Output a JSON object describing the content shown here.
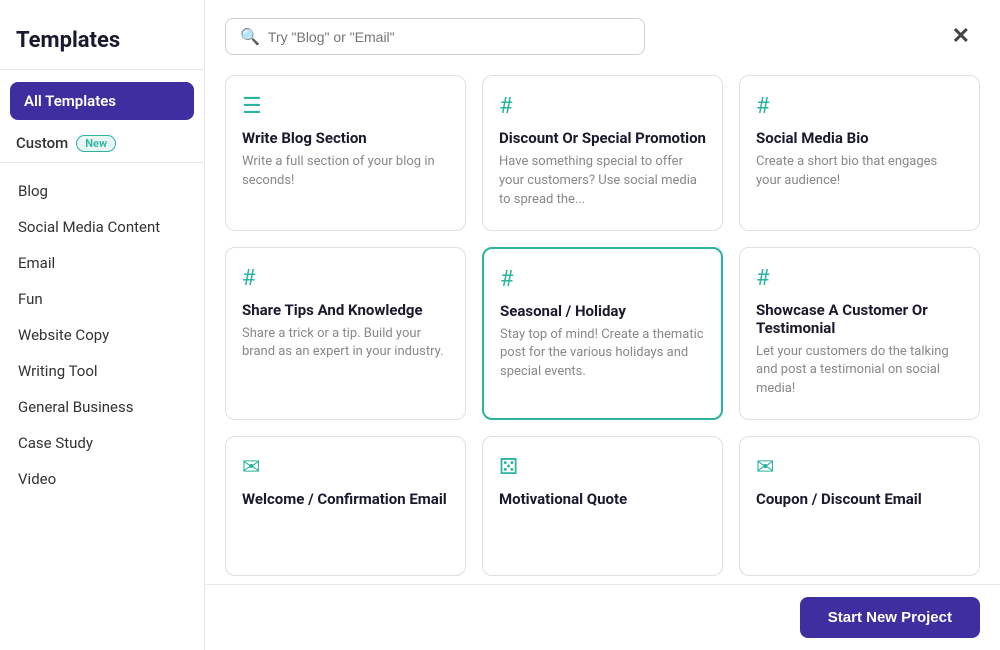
{
  "sidebar": {
    "title": "Templates",
    "all_templates_label": "All Templates",
    "custom_label": "Custom",
    "new_badge": "New",
    "nav_items": [
      {
        "label": "Blog",
        "id": "blog"
      },
      {
        "label": "Social Media Content",
        "id": "social-media-content"
      },
      {
        "label": "Email",
        "id": "email"
      },
      {
        "label": "Fun",
        "id": "fun"
      },
      {
        "label": "Website Copy",
        "id": "website-copy"
      },
      {
        "label": "Writing Tool",
        "id": "writing-tool"
      },
      {
        "label": "General Business",
        "id": "general-business"
      },
      {
        "label": "Case Study",
        "id": "case-study"
      },
      {
        "label": "Video",
        "id": "video"
      }
    ]
  },
  "search": {
    "placeholder": "Try \"Blog\" or \"Email\""
  },
  "close_button": "✕",
  "cards": [
    {
      "id": "write-blog-section",
      "icon": "☰",
      "icon_type": "teal",
      "title": "Write Blog Section",
      "description": "Write a full section of your blog in seconds!",
      "highlighted": false
    },
    {
      "id": "discount-or-special-promotion",
      "icon": "#",
      "icon_type": "teal",
      "title": "Discount Or Special Promotion",
      "description": "Have something special to offer your customers? Use social media to spread the...",
      "highlighted": false
    },
    {
      "id": "social-media-bio",
      "icon": "#",
      "icon_type": "teal",
      "title": "Social Media Bio",
      "description": "Create a short bio that engages your audience!",
      "highlighted": false
    },
    {
      "id": "share-tips-and-knowledge",
      "icon": "#",
      "icon_type": "teal",
      "title": "Share Tips And Knowledge",
      "description": "Share a trick or a tip. Build your brand as an expert in your industry.",
      "highlighted": false
    },
    {
      "id": "seasonal-holiday",
      "icon": "#",
      "icon_type": "teal",
      "title": "Seasonal / Holiday",
      "description": "Stay top of mind! Create a thematic post for the various holidays and special events.",
      "highlighted": true
    },
    {
      "id": "showcase-customer-testimonial",
      "icon": "#",
      "icon_type": "teal",
      "title": "Showcase A Customer Or Testimonial",
      "description": "Let your customers do the talking and post a testimonial on social media!",
      "highlighted": false
    },
    {
      "id": "welcome-confirmation-email",
      "icon": "✉",
      "icon_type": "teal",
      "title": "Welcome / Confirmation Email",
      "description": "",
      "highlighted": false
    },
    {
      "id": "motivational-quote",
      "icon": "⚄",
      "icon_type": "teal",
      "title": "Motivational Quote",
      "description": "",
      "highlighted": false
    },
    {
      "id": "coupon-discount-email",
      "icon": "✉",
      "icon_type": "teal",
      "title": "Coupon / Discount Email",
      "description": "",
      "highlighted": false
    }
  ],
  "start_button": "Start New Project"
}
